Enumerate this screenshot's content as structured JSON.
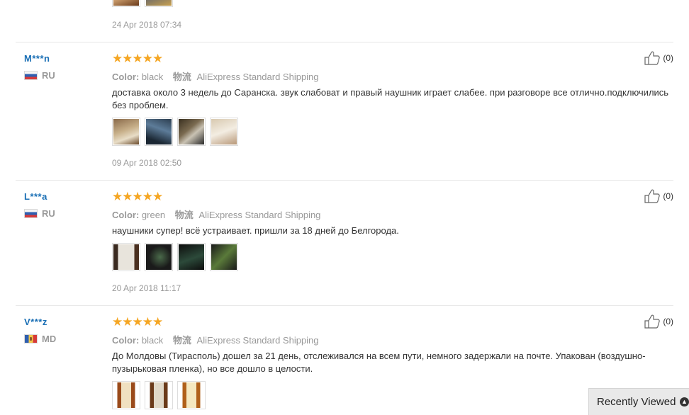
{
  "partial_review": {
    "date": "24 Apr 2018 07:34"
  },
  "reviews": [
    {
      "user": "M***n",
      "country": "RU",
      "flag_icon": "russia-flag-icon",
      "rating": 5,
      "stars": "★★★★★",
      "color_label": "Color:",
      "color_value": "black",
      "shipping_label": "物流",
      "shipping_value": "AliExpress Standard Shipping",
      "text": "доставка около 3 недель до Саранска. звук слабоват и правый наушник играет слабее. при разговоре все отлично.подключились без проблем.",
      "photos": 4,
      "date": "09 Apr 2018 02:50",
      "helpful": "(0)"
    },
    {
      "user": "L***a",
      "country": "RU",
      "flag_icon": "russia-flag-icon",
      "rating": 5,
      "stars": "★★★★★",
      "color_label": "Color:",
      "color_value": "green",
      "shipping_label": "物流",
      "shipping_value": "AliExpress Standard Shipping",
      "text": "наушники супер! всё устраивает. пришли за 18 дней до Белгорода.",
      "photos": 4,
      "date": "20 Apr 2018 11:17",
      "helpful": "(0)"
    },
    {
      "user": "V***z",
      "country": "MD",
      "flag_icon": "moldova-flag-icon",
      "rating": 5,
      "stars": "★★★★★",
      "color_label": "Color:",
      "color_value": "black",
      "shipping_label": "物流",
      "shipping_value": "AliExpress Standard Shipping",
      "text": "До Молдовы (Тирасполь) дошел за 21 день, отслеживался на всем пути, немного задержали на почте. Упакован (воздушно-пузырьковая пленка), но все дошло в целости.",
      "photos": 3,
      "helpful": "(0)"
    }
  ],
  "recently_viewed": {
    "label": "Recently Viewed",
    "icon": "chevron-up-icon"
  },
  "icons": {
    "helpful": "thumbs-up-icon",
    "star": "star-icon"
  },
  "colors": {
    "username": "#1a6fb5",
    "stars": "#f5a623",
    "muted": "#999999"
  }
}
